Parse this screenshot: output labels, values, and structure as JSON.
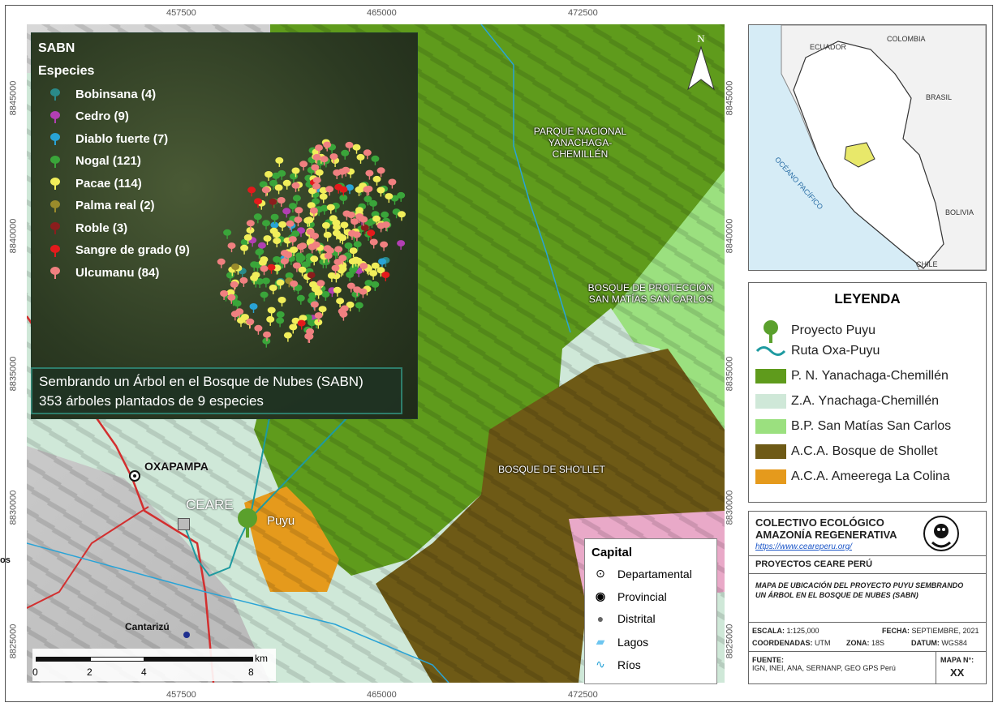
{
  "axis_ticks": {
    "x": [
      "457500",
      "465000",
      "472500"
    ],
    "y": [
      "8845000",
      "8840000",
      "8835000",
      "8830000",
      "8825000"
    ]
  },
  "north_label": "N",
  "inset_panel": {
    "title": "SABN",
    "subtitle": "Especies",
    "species": [
      {
        "label": "Bobinsana (4)",
        "color": "#2a8a8a"
      },
      {
        "label": "Cedro (9)",
        "color": "#b23fb3"
      },
      {
        "label": "Diablo fuerte (7)",
        "color": "#29a3d6"
      },
      {
        "label": "Nogal (121)",
        "color": "#3aa53a"
      },
      {
        "label": "Pacae (114)",
        "color": "#f1ee5a"
      },
      {
        "label": "Palma real (2)",
        "color": "#9a8b2b"
      },
      {
        "label": "Roble (3)",
        "color": "#8b1d1d"
      },
      {
        "label": "Sangre de grado (9)",
        "color": "#e31a1c"
      },
      {
        "label": "Ulcumanu (84)",
        "color": "#f08080"
      }
    ]
  },
  "caption": {
    "line1": "Sembrando un Árbol en el Bosque de Nubes (SABN)",
    "line2": "353 árboles plantados de 9 especies"
  },
  "map_labels": {
    "parque": "PARQUE NACIONAL\nYANACHAGA-CHEMILLÉN",
    "bosque_proteccion": "BOSQUE DE PROTECCIÓN\nSAN MATÍAS SAN CARLOS",
    "shollet": "BOSQUE DE SHO'LLET",
    "oxapampa": "OXAPAMPA",
    "ceare": "CEARE",
    "puyu": "Puyu",
    "cantarizu": "Cantarizú",
    "edge_fragment": "os"
  },
  "scale_bar": {
    "labels": [
      "0",
      "2",
      "4",
      "8"
    ],
    "unit": "km"
  },
  "capital_legend": {
    "title": "Capital",
    "items": [
      "Departamental",
      "Provincial",
      "Distrital",
      "Lagos",
      "Ríos"
    ]
  },
  "peru_inset": {
    "labels": [
      "ECUADOR",
      "COLOMBIA",
      "BRASIL",
      "OCÉANO PACÍFICO",
      "BOLIVIA",
      "CHILE"
    ]
  },
  "legend": {
    "title": "LEYENDA",
    "items": [
      {
        "label": "Proyecto Puyu",
        "kind": "tree-icon",
        "color": "#5aa02c"
      },
      {
        "label": "Ruta Oxa-Puyu",
        "kind": "route-line",
        "color": "#1e9aa0"
      },
      {
        "label": "P. N. Yanachaga-Chemillén",
        "kind": "fill",
        "color": "#5f9b1c"
      },
      {
        "label": "Z.A. Ynachaga-Chemillén",
        "kind": "fill",
        "color": "#cfe8d8"
      },
      {
        "label": "B.P. San Matías San Carlos",
        "kind": "fill",
        "color": "#9be07f"
      },
      {
        "label": "A.C.A. Bosque de Shollet",
        "kind": "fill",
        "color": "#6e5a16"
      },
      {
        "label": "A.C.A. Ameerega La Colina",
        "kind": "fill",
        "color": "#e59a1c"
      }
    ]
  },
  "info": {
    "org_line1": "COLECTIVO ECOLÓGICO",
    "org_line2": "AMAZONÍA REGENERATIVA",
    "url": "https://www.ceareperu.org/",
    "projects": "PROYECTOS CEARE PERÚ",
    "map_title": "MAPA DE UBICACIÓN DEL PROYECTO PUYU SEMBRANDO UN ÁRBOL EN EL BOSQUE DE NUBES (SABN)",
    "escala_label": "ESCALA:",
    "escala_value": "1:125,000",
    "fecha_label": "FECHA:",
    "fecha_value": "SEPTIEMBRE, 2021",
    "coord_label": "COORDENADAS:",
    "coord_value": "UTM",
    "zona_label": "ZONA:",
    "zona_value": "18S",
    "datum_label": "DATUM:",
    "datum_value": "WGS84",
    "fuente_label": "FUENTE:",
    "fuente_value": "IGN, INEI, ANA, SERNANP, GEO GPS Perú",
    "mapa_label": "MAPA N°:",
    "mapa_value": "XX"
  }
}
